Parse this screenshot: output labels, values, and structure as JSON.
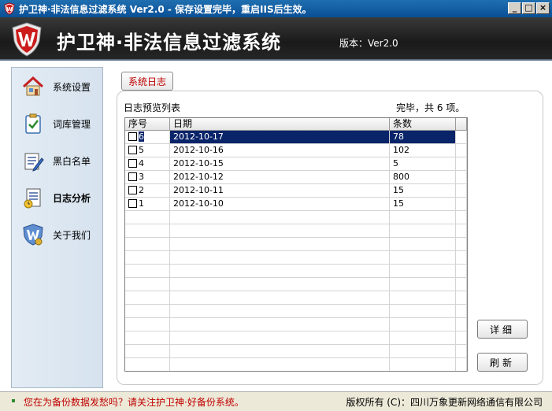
{
  "window": {
    "title": "护卫神·非法信息过滤系统 Ver2.0 - 保存设置完毕，重启IIS后生效。",
    "minimize": "_",
    "maximize": "□",
    "close": "×"
  },
  "header": {
    "app_name": "护卫神·非法信息过滤系统",
    "version": "版本：Ver2.0"
  },
  "sidebar": {
    "items": [
      {
        "label": "系统设置",
        "icon": "home-icon"
      },
      {
        "label": "词库管理",
        "icon": "clipboard-check-icon"
      },
      {
        "label": "黑白名单",
        "icon": "list-pen-icon"
      },
      {
        "label": "日志分析",
        "icon": "log-report-icon",
        "active": true
      },
      {
        "label": "关于我们",
        "icon": "shield-w-icon"
      }
    ]
  },
  "main": {
    "tab_label": "系统日志",
    "list_caption": "日志预览列表",
    "status_text": "完毕，共 6 项。",
    "table": {
      "headers": [
        "序号",
        "日期",
        "条数"
      ],
      "rows": [
        {
          "id": "6",
          "date": "2012-10-17",
          "count": "78",
          "selected": true
        },
        {
          "id": "5",
          "date": "2012-10-16",
          "count": "102"
        },
        {
          "id": "4",
          "date": "2012-10-15",
          "count": "5"
        },
        {
          "id": "3",
          "date": "2012-10-12",
          "count": "800"
        },
        {
          "id": "2",
          "date": "2012-10-11",
          "count": "15"
        },
        {
          "id": "1",
          "date": "2012-10-10",
          "count": "15"
        }
      ]
    },
    "detail_button": "详细",
    "refresh_button": "刷新"
  },
  "statusbar": {
    "left": "您在为备份数据发愁吗？请关注护卫神·好备份系统。",
    "right": "版权所有 (C)：四川万象更新网络通信有限公司"
  },
  "colors": {
    "selection": "#0a246a",
    "accent_red": "#c00000",
    "title_blue": "#0a4f96"
  }
}
